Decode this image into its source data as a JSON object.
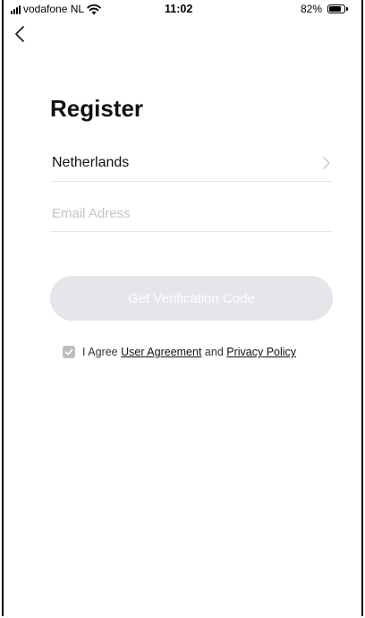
{
  "status_bar": {
    "carrier": "vodafone NL",
    "time": "11:02",
    "battery_percent": "82%",
    "battery_level": 0.82,
    "signal_icon": "signal-bars-icon",
    "wifi_icon": "wifi-icon",
    "battery_icon": "battery-icon"
  },
  "nav": {
    "back_icon": "chevron-left-icon"
  },
  "page": {
    "title": "Register"
  },
  "form": {
    "country": "Netherlands",
    "country_chevron_icon": "chevron-right-icon",
    "email_value": "",
    "email_placeholder": "Email Adress",
    "submit_label": "Get Verification Code"
  },
  "agreement": {
    "checked": true,
    "prefix": "I Agree",
    "user_agreement_link": "User Agreement",
    "conjunction": "and",
    "privacy_policy_link": "Privacy Policy"
  },
  "colors": {
    "button_disabled_bg": "#e5e5ea",
    "button_text": "#ffffff",
    "checkbox_checked": "#bdbdbd",
    "divider": "#e6e6e6",
    "placeholder": "#c4c4c4"
  }
}
